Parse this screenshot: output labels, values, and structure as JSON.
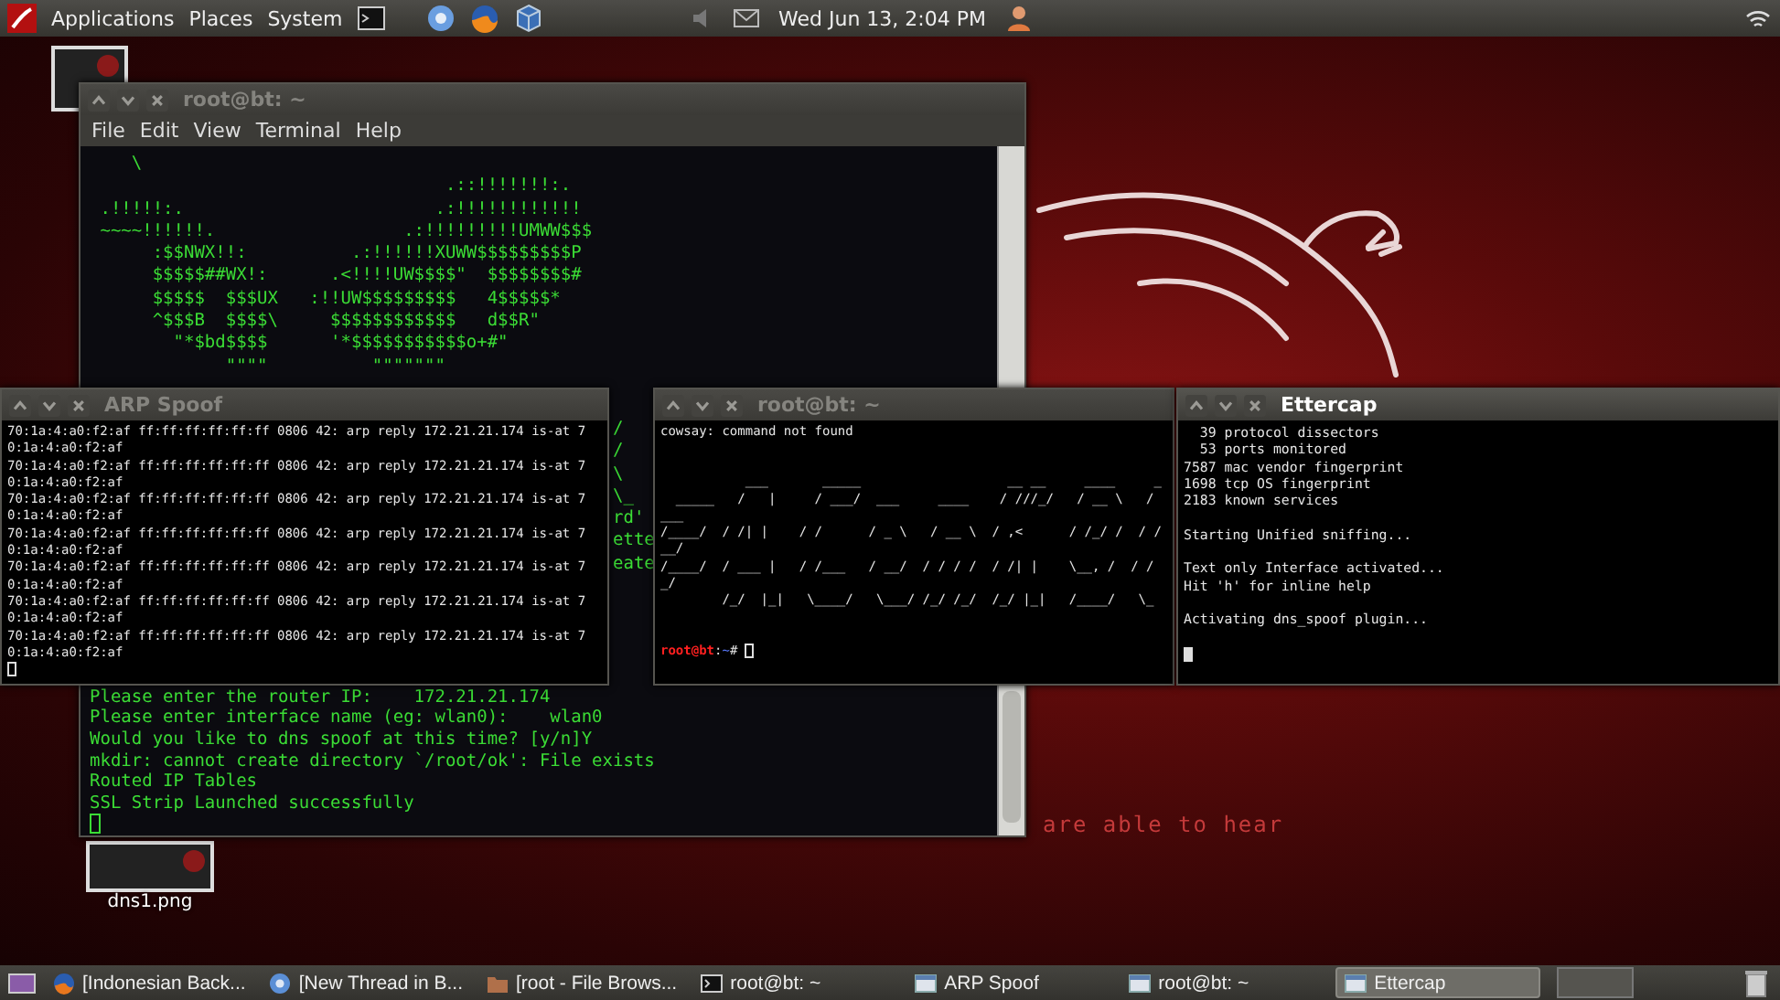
{
  "top_panel": {
    "menus": [
      "Applications",
      "Places",
      "System"
    ],
    "clock": "Wed Jun 13,  2:04 PM"
  },
  "desktop": {
    "wallpaper_text": "are able to hear",
    "icons": [
      {
        "label": "dns1.png"
      }
    ]
  },
  "main_terminal": {
    "title": "root@bt: ~",
    "active": false,
    "menu": [
      "File",
      "Edit",
      "View",
      "Terminal",
      "Help"
    ],
    "art_lines": [
      "    \\",
      "                                  .::!!!!!!!:.",
      " .!!!!!:.                        .:!!!!!!!!!!!!",
      " ~~~~!!!!!!.                  .:!!!!!!!!!UMWW$$$",
      "      :$$NWX!!:          .:!!!!!!XUWW$$$$$$$$$P",
      "      $$$$$##WX!:      .<!!!!UW$$$$\"  $$$$$$$$#",
      "      $$$$$  $$$UX   :!!UW$$$$$$$$$   4$$$$$*",
      "      ^$$$B  $$$$\\     $$$$$$$$$$$$   d$$R\"",
      "        \"*$bd$$$$      '*$$$$$$$$$$$o+#\"",
      "             \"\"\"\"          \"\"\"\"\"\"\""
    ],
    "fragments": [
      "/",
      "/",
      "\\",
      "\\_",
      "rd'",
      "ette",
      "eate"
    ],
    "lines": [
      "Please enter the router IP:    172.21.21.174",
      "Please enter interface name (eg: wlan0):    wlan0",
      "Would you like to dns spoof at this time? [y/n]Y",
      "mkdir: cannot create directory `/root/ok': File exists",
      "Routed IP Tables",
      "SSL Strip Launched successfully"
    ]
  },
  "arp_spoof_window": {
    "title": "ARP Spoof",
    "active": false,
    "lines": [
      "70:1a:4:a0:f2:af ff:ff:ff:ff:ff:ff 0806 42: arp reply 172.21.21.174 is-at 7",
      "0:1a:4:a0:f2:af",
      "70:1a:4:a0:f2:af ff:ff:ff:ff:ff:ff 0806 42: arp reply 172.21.21.174 is-at 7",
      "0:1a:4:a0:f2:af",
      "70:1a:4:a0:f2:af ff:ff:ff:ff:ff:ff 0806 42: arp reply 172.21.21.174 is-at 7",
      "0:1a:4:a0:f2:af",
      "70:1a:4:a0:f2:af ff:ff:ff:ff:ff:ff 0806 42: arp reply 172.21.21.174 is-at 7",
      "0:1a:4:a0:f2:af",
      "70:1a:4:a0:f2:af ff:ff:ff:ff:ff:ff 0806 42: arp reply 172.21.21.174 is-at 7",
      "0:1a:4:a0:f2:af",
      "70:1a:4:a0:f2:af ff:ff:ff:ff:ff:ff 0806 42: arp reply 172.21.21.174 is-at 7",
      "0:1a:4:a0:f2:af",
      "70:1a:4:a0:f2:af ff:ff:ff:ff:ff:ff 0806 42: arp reply 172.21.21.174 is-at 7",
      "0:1a:4:a0:f2:af"
    ]
  },
  "second_terminal": {
    "title": "root@bt: ~",
    "active": false,
    "error": "cowsay: command not found",
    "art_lines": [
      "           ___       _____                   __ __     ____     _",
      "  _____   /   |     / ___/  ___     ____    / ///_/   / __ \\   /",
      "___",
      "/____/  / /| |    / /      / _ \\   / __ \\  / ,<      / /_/ /  / /",
      "__/",
      "/____/  / ___ |   / /___   / __/  / / / /  / /| |    \\__, /  / /",
      "_/",
      "        /_/  |_|   \\____/   \\___/ /_/ /_/  /_/ |_|   /____/   \\_"
    ],
    "prompt": [
      {
        "kind": "user",
        "text": "root@bt"
      },
      {
        "kind": "plain",
        "text": ":"
      },
      {
        "kind": "path",
        "text": "~"
      },
      {
        "kind": "plain",
        "text": "#"
      }
    ]
  },
  "ettercap_window": {
    "title": "Ettercap",
    "active": true,
    "paragraphs": [
      [
        "  39 protocol dissectors",
        "  53 ports monitored",
        "7587 mac vendor fingerprint",
        "1698 tcp OS fingerprint",
        "2183 known services"
      ],
      [
        "Starting Unified sniffing..."
      ],
      [
        "Text only Interface activated...",
        "Hit 'h' for inline help"
      ],
      [
        "Activating dns_spoof plugin..."
      ]
    ]
  },
  "taskbar": {
    "items": [
      {
        "kind": "fox",
        "label": "[Indonesian Back...",
        "selected": false
      },
      {
        "kind": "globe",
        "label": "[New Thread in B...",
        "selected": false
      },
      {
        "kind": "folder",
        "label": "[root - File Brows...",
        "selected": false
      },
      {
        "kind": "terminal",
        "label": "root@bt: ~",
        "selected": false
      },
      {
        "kind": "window",
        "label": "ARP Spoof",
        "selected": false
      },
      {
        "kind": "window",
        "label": "root@bt: ~",
        "selected": false
      },
      {
        "kind": "window",
        "label": "Ettercap",
        "selected": true
      }
    ]
  }
}
